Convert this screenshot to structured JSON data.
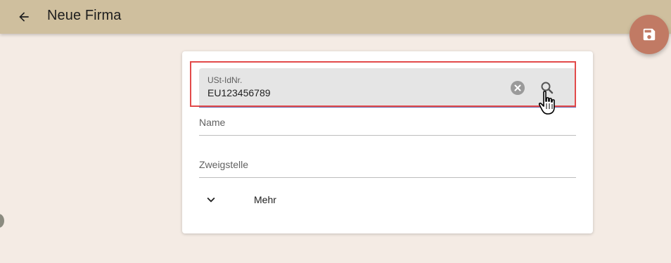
{
  "header": {
    "title": "Neue Firma",
    "back_icon": "arrow-left-icon"
  },
  "fab": {
    "icon": "save-icon",
    "color": "#c17a64"
  },
  "form": {
    "vat": {
      "label": "USt-IdNr.",
      "value": "EU123456789",
      "clear_icon": "clear-circle-icon",
      "search_icon": "search-icon"
    },
    "name": {
      "placeholder": "Name"
    },
    "branch": {
      "placeholder": "Zweigstelle"
    },
    "more": {
      "label": "Mehr",
      "icon": "chevron-down-icon"
    }
  },
  "colors": {
    "appbar": "#cfbf9e",
    "background": "#f4ebe4",
    "highlight": "#e24a4a"
  }
}
